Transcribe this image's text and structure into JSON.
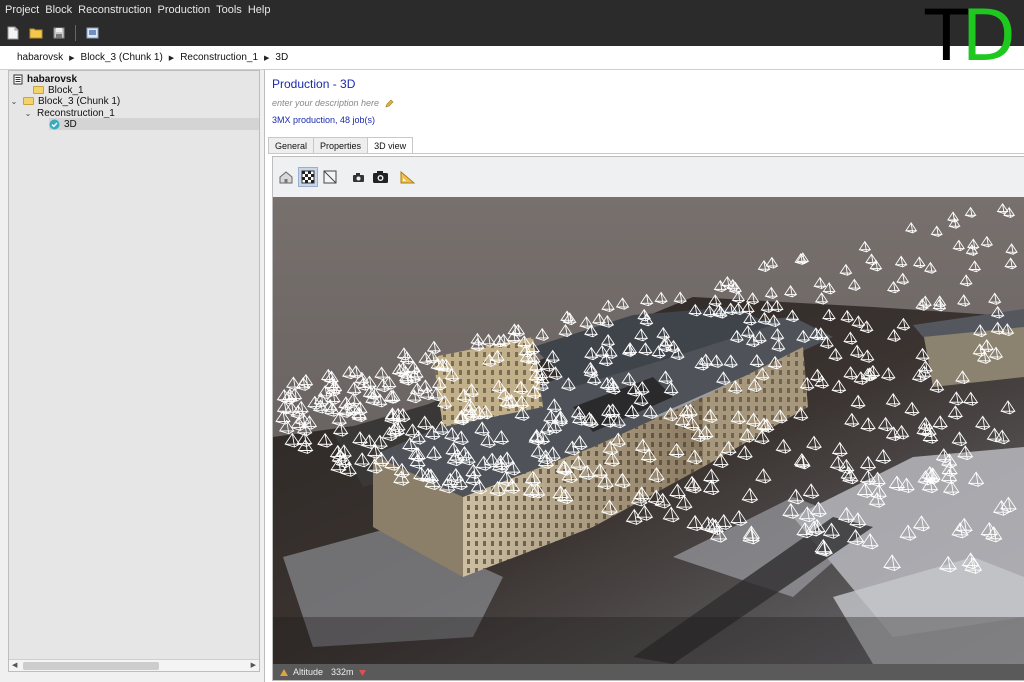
{
  "menubar": {
    "items": [
      "Project",
      "Block",
      "Reconstruction",
      "Production",
      "Tools",
      "Help"
    ]
  },
  "toolbar": {
    "icons": [
      "new-project-icon",
      "open-project-icon",
      "save-project-icon",
      "screenshot-icon"
    ]
  },
  "logo": {
    "t": "T",
    "d": "D",
    "d_color": "#1fc81f"
  },
  "breadcrumb": [
    "habarovsk",
    "Block_3 (Chunk 1)",
    "Reconstruction_1",
    "3D"
  ],
  "tree": {
    "root": "habarovsk",
    "block1": "Block_1",
    "block3": "Block_3 (Chunk 1)",
    "reconstruction": "Reconstruction_1",
    "production": "3D"
  },
  "production": {
    "title": "Production - 3D",
    "description_placeholder": "enter your description here",
    "jobs": "3MX production, 48 job(s)",
    "tabs": [
      "General",
      "Properties",
      "3D view"
    ],
    "active_tab": "3D view"
  },
  "viewer": {
    "tools": [
      "home-icon",
      "texture-icon",
      "wireframe-icon",
      "camera-icon",
      "camera-large-icon",
      "measure-icon"
    ],
    "altitude_label": "Altitude",
    "altitude_value": "332m"
  },
  "colors": {
    "menubar_bg": "#2b2b2b",
    "title_blue": "#1a2ab0",
    "sky": "#6e6967",
    "snow": "#cfd0d4",
    "building": "#cdbfa5"
  }
}
